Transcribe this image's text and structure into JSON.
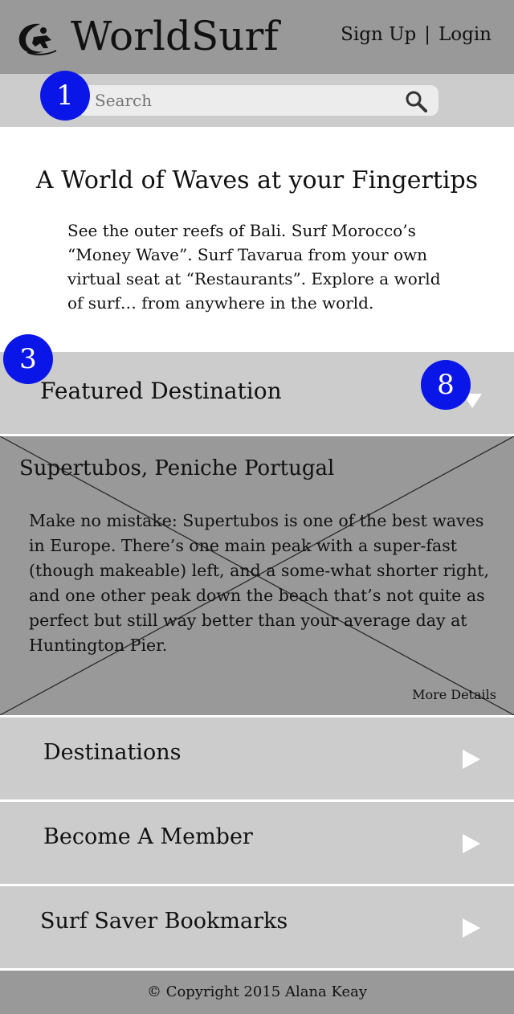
{
  "header": {
    "logo_text": "WorldSurf",
    "signup_label": "Sign Up",
    "separator": "|",
    "login_label": "Login"
  },
  "search": {
    "placeholder": "Search"
  },
  "annotations": {
    "badge_1": "1",
    "badge_3": "3",
    "badge_8": "8"
  },
  "hero": {
    "title": "A World of Waves at your Fingertips",
    "body": "See the outer reefs of Bali. Surf Morocco’s “Money Wave”. Surf Tavarua from your own virtual seat at “Restaurants”. Explore a world of surf… from anywhere in the world."
  },
  "featured": {
    "section_title": "Featured Destination",
    "name": "Supertubos, Peniche Portugal",
    "description": "Make no mistake: Supertubos is one of the best waves in Europe. There’s one main peak with a super-fast (though makeable) left, and a some-what shorter right, and one other peak down the beach that’s not quite as perfect but still way better than your average day at Huntington Pier.",
    "more_label": "More Details"
  },
  "nav": [
    {
      "label": "Destinations"
    },
    {
      "label": "Become A Member"
    },
    {
      "label": "Surf Saver Bookmarks"
    }
  ],
  "footer": {
    "copyright": "© Copyright 2015 Alana Keay"
  },
  "colors": {
    "header_bg": "#999999",
    "panel_bg": "#cccccc",
    "badge_blue": "#0a16e8",
    "arrow_white": "#ffffff"
  }
}
